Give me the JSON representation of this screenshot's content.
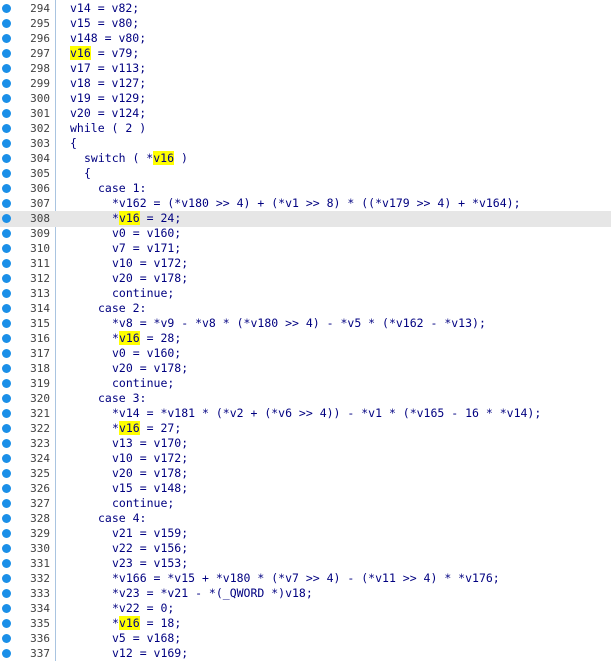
{
  "editor": {
    "highlight_color": "#ffff00",
    "current_line_color": "#e6e6e6",
    "breakpoint_color": "#1a8fe8",
    "current_line": 308,
    "lines": [
      {
        "num": "294",
        "indent": 0,
        "tokens": [
          {
            "t": "v14 = v82;"
          }
        ]
      },
      {
        "num": "295",
        "indent": 0,
        "tokens": [
          {
            "t": "v15 = v80;"
          }
        ]
      },
      {
        "num": "296",
        "indent": 0,
        "tokens": [
          {
            "t": "v148 = v80;"
          }
        ]
      },
      {
        "num": "297",
        "indent": 0,
        "tokens": [
          {
            "t": "v16",
            "hl": true
          },
          {
            "t": " = v79;"
          }
        ]
      },
      {
        "num": "298",
        "indent": 0,
        "tokens": [
          {
            "t": "v17 = v113;"
          }
        ]
      },
      {
        "num": "299",
        "indent": 0,
        "tokens": [
          {
            "t": "v18 = v127;"
          }
        ]
      },
      {
        "num": "300",
        "indent": 0,
        "tokens": [
          {
            "t": "v19 = v129;"
          }
        ]
      },
      {
        "num": "301",
        "indent": 0,
        "tokens": [
          {
            "t": "v20 = v124;"
          }
        ]
      },
      {
        "num": "302",
        "indent": 0,
        "tokens": [
          {
            "t": "while ( 2 )"
          }
        ]
      },
      {
        "num": "303",
        "indent": 0,
        "tokens": [
          {
            "t": "{"
          }
        ]
      },
      {
        "num": "304",
        "indent": 1,
        "tokens": [
          {
            "t": "switch ( *"
          },
          {
            "t": "v16",
            "hl": true
          },
          {
            "t": " )"
          }
        ]
      },
      {
        "num": "305",
        "indent": 1,
        "tokens": [
          {
            "t": "{"
          }
        ]
      },
      {
        "num": "306",
        "indent": 2,
        "tokens": [
          {
            "t": "case 1:"
          }
        ]
      },
      {
        "num": "307",
        "indent": 3,
        "tokens": [
          {
            "t": "*v162 = (*v180 >> 4) + (*v1 >> 8) * ((*v179 >> 4) + *v164);"
          }
        ]
      },
      {
        "num": "308",
        "indent": 3,
        "tokens": [
          {
            "t": "*"
          },
          {
            "t": "v16",
            "hl": true
          },
          {
            "t": " = 24;"
          }
        ]
      },
      {
        "num": "309",
        "indent": 3,
        "tokens": [
          {
            "t": "v0 = v160;"
          }
        ]
      },
      {
        "num": "310",
        "indent": 3,
        "tokens": [
          {
            "t": "v7 = v171;"
          }
        ]
      },
      {
        "num": "311",
        "indent": 3,
        "tokens": [
          {
            "t": "v10 = v172;"
          }
        ]
      },
      {
        "num": "312",
        "indent": 3,
        "tokens": [
          {
            "t": "v20 = v178;"
          }
        ]
      },
      {
        "num": "313",
        "indent": 3,
        "tokens": [
          {
            "t": "continue;"
          }
        ]
      },
      {
        "num": "314",
        "indent": 2,
        "tokens": [
          {
            "t": "case 2:"
          }
        ]
      },
      {
        "num": "315",
        "indent": 3,
        "tokens": [
          {
            "t": "*v8 = *v9 - *v8 * (*v180 >> 4) - *v5 * (*v162 - *v13);"
          }
        ]
      },
      {
        "num": "316",
        "indent": 3,
        "tokens": [
          {
            "t": "*"
          },
          {
            "t": "v16",
            "hl": true
          },
          {
            "t": " = 28;"
          }
        ]
      },
      {
        "num": "317",
        "indent": 3,
        "tokens": [
          {
            "t": "v0 = v160;"
          }
        ]
      },
      {
        "num": "318",
        "indent": 3,
        "tokens": [
          {
            "t": "v20 = v178;"
          }
        ]
      },
      {
        "num": "319",
        "indent": 3,
        "tokens": [
          {
            "t": "continue;"
          }
        ]
      },
      {
        "num": "320",
        "indent": 2,
        "tokens": [
          {
            "t": "case 3:"
          }
        ]
      },
      {
        "num": "321",
        "indent": 3,
        "tokens": [
          {
            "t": "*v14 = *v181 * (*v2 + (*v6 >> 4)) - *v1 * (*v165 - 16 * *v14);"
          }
        ]
      },
      {
        "num": "322",
        "indent": 3,
        "tokens": [
          {
            "t": "*"
          },
          {
            "t": "v16",
            "hl": true
          },
          {
            "t": " = 27;"
          }
        ]
      },
      {
        "num": "323",
        "indent": 3,
        "tokens": [
          {
            "t": "v13 = v170;"
          }
        ]
      },
      {
        "num": "324",
        "indent": 3,
        "tokens": [
          {
            "t": "v10 = v172;"
          }
        ]
      },
      {
        "num": "325",
        "indent": 3,
        "tokens": [
          {
            "t": "v20 = v178;"
          }
        ]
      },
      {
        "num": "326",
        "indent": 3,
        "tokens": [
          {
            "t": "v15 = v148;"
          }
        ]
      },
      {
        "num": "327",
        "indent": 3,
        "tokens": [
          {
            "t": "continue;"
          }
        ]
      },
      {
        "num": "328",
        "indent": 2,
        "tokens": [
          {
            "t": "case 4:"
          }
        ]
      },
      {
        "num": "329",
        "indent": 3,
        "tokens": [
          {
            "t": "v21 = v159;"
          }
        ]
      },
      {
        "num": "330",
        "indent": 3,
        "tokens": [
          {
            "t": "v22 = v156;"
          }
        ]
      },
      {
        "num": "331",
        "indent": 3,
        "tokens": [
          {
            "t": "v23 = v153;"
          }
        ]
      },
      {
        "num": "332",
        "indent": 3,
        "tokens": [
          {
            "t": "*v166 = *v15 + *v180 * (*v7 >> 4) - (*v11 >> 4) * *v176;"
          }
        ]
      },
      {
        "num": "333",
        "indent": 3,
        "tokens": [
          {
            "t": "*v23 = *v21 - *(_QWORD *)v18;"
          }
        ]
      },
      {
        "num": "334",
        "indent": 3,
        "tokens": [
          {
            "t": "*v22 = 0;"
          }
        ]
      },
      {
        "num": "335",
        "indent": 3,
        "tokens": [
          {
            "t": "*"
          },
          {
            "t": "v16",
            "hl": true
          },
          {
            "t": " = 18;"
          }
        ]
      },
      {
        "num": "336",
        "indent": 3,
        "tokens": [
          {
            "t": "v5 = v168;"
          }
        ]
      },
      {
        "num": "337",
        "indent": 3,
        "tokens": [
          {
            "t": "v12 = v169;"
          }
        ]
      }
    ]
  }
}
